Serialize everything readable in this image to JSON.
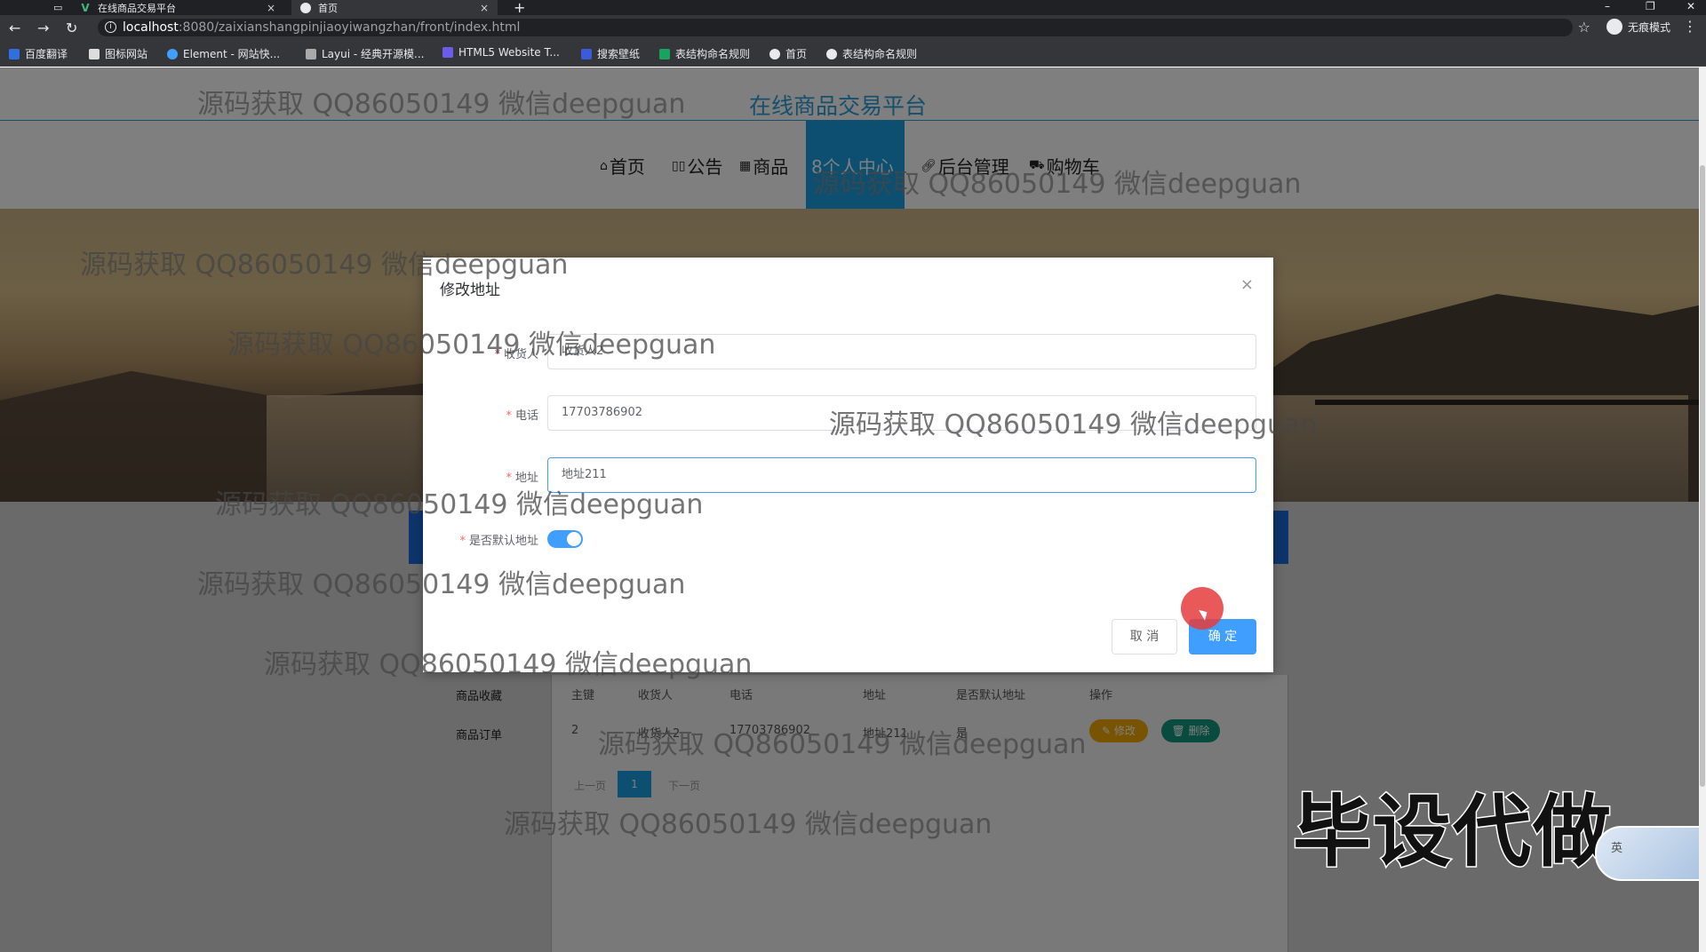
{
  "browser": {
    "tabs": [
      {
        "label": "在线商品交易平台",
        "close": "×"
      },
      {
        "label": "首页",
        "close": "×"
      }
    ],
    "new_tab": "+",
    "url_host": "localhost",
    "url_path": ":8080/zaixianshangpinjiaoyiwangzhan/front/index.html",
    "profile_label": "无痕模式",
    "bookmarks": [
      "百度翻译",
      "图标网站",
      "Element - 网站快...",
      "Layui - 经典开源模...",
      "HTML5 Website T...",
      "搜索壁纸",
      "表结构命名规则",
      "首页",
      "表结构命名规则"
    ]
  },
  "site": {
    "title": "在线商品交易平台",
    "nav": [
      "首页",
      "公告",
      "商品",
      "个人中心",
      "后台管理",
      "购物车"
    ],
    "active_nav": "个人中心"
  },
  "background_page": {
    "side_items": [
      "商品收藏",
      "商品订单"
    ],
    "table_headers": [
      "主键",
      "收货人",
      "电话",
      "地址",
      "是否默认地址",
      "操作"
    ],
    "table_row": [
      "2",
      "收货人2",
      "17703786902",
      "地址211",
      "是"
    ],
    "edit_label": "修改",
    "delete_label": "删除",
    "pager_prev": "上一页",
    "pager_current": "1",
    "pager_next": "下一页"
  },
  "dialog": {
    "title": "修改地址",
    "close": "×",
    "fields": [
      {
        "label": "收货人",
        "value": "收货人2"
      },
      {
        "label": "电话",
        "value": "17703786902"
      },
      {
        "label": "地址",
        "value": "地址211"
      }
    ],
    "default_label": "是否默认地址",
    "default_on": true,
    "cancel_label": "取 消",
    "ok_label": "确 定"
  },
  "watermark_text": "源码获取 QQ86050149 微信deepguan",
  "badge_text": "毕设代做",
  "widget_text": "英",
  "colors": {
    "primary": "#409eff",
    "site_blue": "#1a9fe3",
    "edit": "#f0a900",
    "delete": "#13967d"
  }
}
